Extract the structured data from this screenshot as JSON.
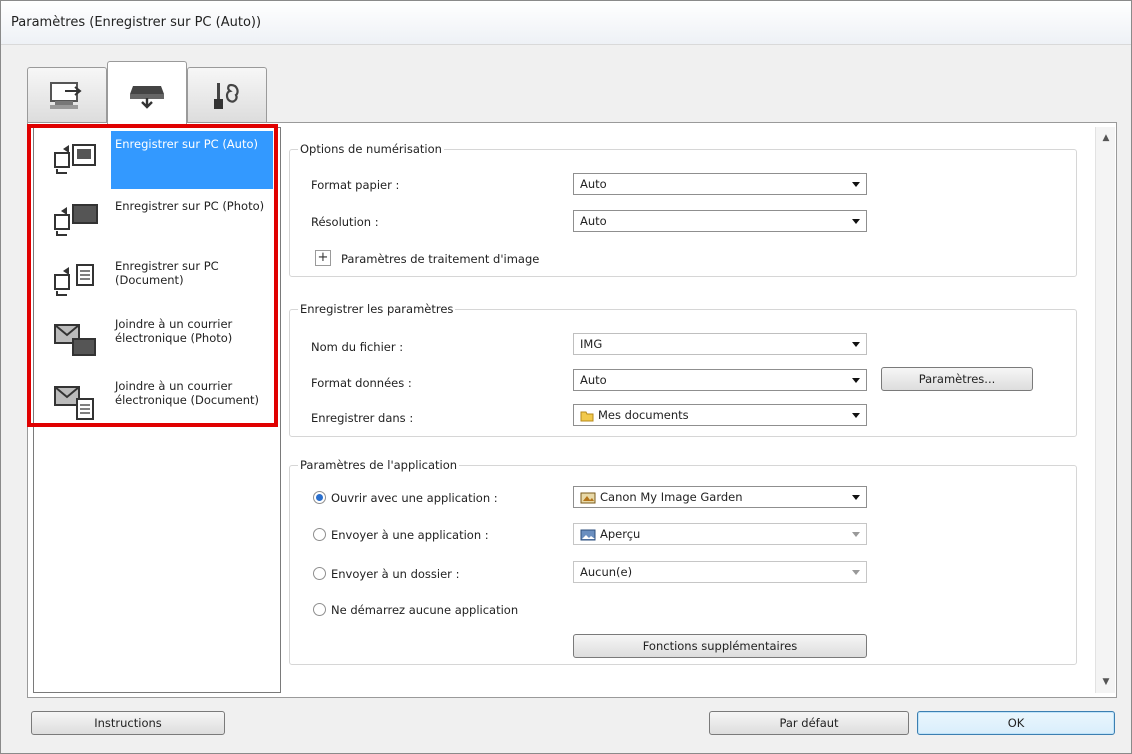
{
  "window": {
    "title": "Paramètres (Enregistrer sur PC (Auto))"
  },
  "tabs": [
    {
      "icon": "monitor-scan-icon"
    },
    {
      "icon": "scanner-save-icon"
    },
    {
      "icon": "tools-icon"
    }
  ],
  "sidebar": {
    "items": [
      {
        "label": "Enregistrer sur PC (Auto)",
        "icon": "save-auto-icon",
        "selected": true
      },
      {
        "label": "Enregistrer sur PC (Photo)",
        "icon": "save-photo-icon"
      },
      {
        "label": "Enregistrer sur PC (Document)",
        "icon": "save-document-icon"
      },
      {
        "label": "Joindre à un courrier électronique (Photo)",
        "icon": "email-photo-icon"
      },
      {
        "label": "Joindre à un courrier électronique (Document)",
        "icon": "email-document-icon"
      }
    ]
  },
  "scan_options": {
    "title": "Options de numérisation",
    "paper_size_label": "Format papier :",
    "paper_size_value": "Auto",
    "resolution_label": "Résolution :",
    "resolution_value": "Auto",
    "image_processing_label": "Paramètres de traitement d'image"
  },
  "save_settings": {
    "title": "Enregistrer les paramètres",
    "filename_label": "Nom du fichier :",
    "filename_value": "IMG",
    "data_format_label": "Format données :",
    "data_format_value": "Auto",
    "settings_button": "Paramètres...",
    "save_in_label": "Enregistrer dans :",
    "save_in_value": "Mes documents"
  },
  "app_settings": {
    "title": "Paramètres de l'application",
    "open_app_label": "Ouvrir avec une application :",
    "open_app_value": "Canon My Image Garden",
    "send_app_label": "Envoyer à une application :",
    "send_app_value": "Aperçu",
    "send_folder_label": "Envoyer à un dossier :",
    "send_folder_value": "Aucun(e)",
    "no_app_label": "Ne démarrez aucune application",
    "extra_button": "Fonctions supplémentaires"
  },
  "footer": {
    "instructions_button": "Instructions",
    "defaults_button": "Par défaut",
    "ok_button": "OK"
  },
  "colors": {
    "selection": "#3399ff",
    "highlight_border": "#e00000"
  }
}
